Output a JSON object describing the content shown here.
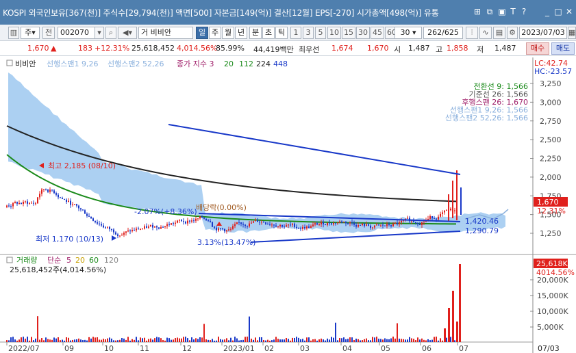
{
  "titlebar": {
    "text": "KOSPI 외국인보유[367(천)] 주식수[29,794(천)] 액면[500] 자본금[149(억)] 결산[12월] EPS[-270] 시가총액[498(억)] 유통",
    "icons": [
      "link-icon",
      "copy-icon",
      "lock-icon",
      "font-icon",
      "help-icon",
      "minimize-icon",
      "restore-icon",
      "close-icon"
    ]
  },
  "toolbar": {
    "period_select": "주",
    "prefix": "전",
    "code": "002070",
    "name": "거 비비안",
    "periods": [
      "일",
      "주",
      "월",
      "년",
      "분",
      "초",
      "틱"
    ],
    "period_active": "일",
    "intervals": [
      "1",
      "3",
      "5",
      "10",
      "15",
      "30",
      "45",
      "60"
    ],
    "interval_value": "30",
    "range": "262/625",
    "date": "2023/07/03"
  },
  "quote": {
    "price": "1,670",
    "arrow": "▲",
    "change": "183",
    "change_pct": "+12.31%",
    "volume": "25,618,452",
    "vol_pct": "4,014.56%",
    "ratio": "85.99%",
    "amount": "44,419백만",
    "best_label": "최우선",
    "best_ask": "1,674",
    "best_bid": "1,670",
    "open_label": "시",
    "open": "1,487",
    "high_label": "고",
    "high": "1,858",
    "low_label": "저",
    "low": "1,487",
    "buy": "매수",
    "sell": "매도"
  },
  "colors": {
    "up": "#e0201c",
    "down": "#1838c8",
    "titlebar": "#4f7fae",
    "cloud": "#9ec8f0",
    "baseline": "#1a8a1a",
    "ma": "#222222"
  },
  "legend_top": {
    "name": "비비안",
    "span1": "선행스팬1 9,26",
    "span2": "선행스팬2 52,26",
    "ma_label": "종가 지수 3",
    "ma1": "20",
    "ma2": "112",
    "ma3": "224",
    "ma4": "448"
  },
  "legend_right": [
    {
      "label": "전환선 9: 1,566",
      "color": "#1a8a1a"
    },
    {
      "label": "기준선 26: 1,566",
      "color": "#555555"
    },
    {
      "label": "후행스팬 26: 1,670",
      "color": "#a0206a"
    },
    {
      "label": "선행스팬1 9,26: 1,566",
      "color": "#8ab0dd"
    },
    {
      "label": "선행스팬2 52,26: 1,566",
      "color": "#8ab0dd"
    }
  ],
  "price_axis": {
    "lc": "LC:42.74",
    "hc": "HC:-23.57",
    "ticks": [
      "3,250",
      "3,000",
      "2,750",
      "2,500",
      "2,250",
      "2,000",
      "1,750",
      "1,500",
      "1,250"
    ],
    "current": "1,670",
    "current_pct": "12.31%"
  },
  "annotations": {
    "high": "최고 2,185 (08/10)",
    "low": "최저 1,170 (10/13)",
    "pct_a": "-2.07%(+8.36%)",
    "pct_b": "배당락(0.00%)",
    "pct_c": "3.13%(13.47%)",
    "level_a": "1,420.46",
    "level_b": "1,290.79"
  },
  "volume_legend": {
    "label": "거래량",
    "simple": "단순",
    "v1": "5",
    "v2": "20",
    "v3": "60",
    "v4": "120",
    "value": "25,618,452주(4,014.56%)"
  },
  "volume_axis": {
    "ticks": [
      "20,000K",
      "15,000K",
      "10,000K",
      "5,000K"
    ],
    "current": "25,618K",
    "current_pct": "4014.56%"
  },
  "x_axis": {
    "labels": [
      "2022/07",
      "09",
      "10",
      "11",
      "12",
      "2023/01",
      "02",
      "03",
      "04",
      "05",
      "06",
      "07"
    ],
    "end": "07/03"
  }
}
